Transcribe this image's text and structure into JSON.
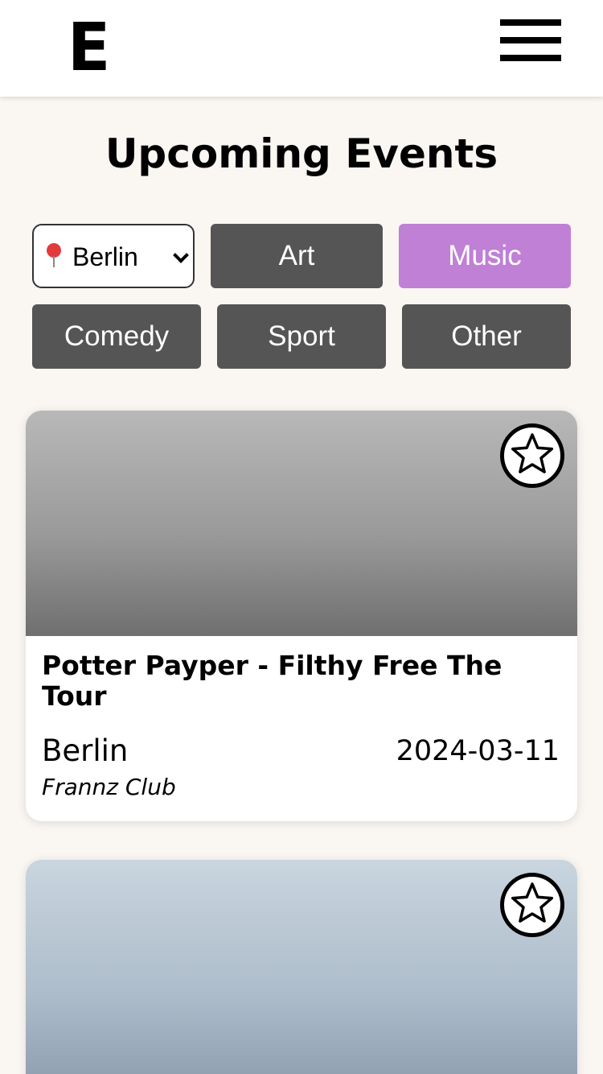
{
  "header": {
    "logo_text": "E",
    "menu_icon": "hamburger-menu-icon"
  },
  "page": {
    "title": "Upcoming Events"
  },
  "filters": {
    "city": {
      "selected": "Berlin",
      "icon": "location-pin-icon"
    },
    "categories": [
      {
        "label": "Art",
        "active": false
      },
      {
        "label": "Music",
        "active": true
      },
      {
        "label": "Comedy",
        "active": false
      },
      {
        "label": "Sport",
        "active": false
      },
      {
        "label": "Other",
        "active": false
      }
    ],
    "active_color": "#bf80d5",
    "inactive_color": "#555555"
  },
  "events": [
    {
      "title": "Potter Payper - Filthy Free The Tour",
      "city": "Berlin",
      "date": "2024-03-11",
      "venue": "Frannz Club",
      "favorite_icon": "star-outline-icon"
    },
    {
      "title": "",
      "city": "",
      "date": "",
      "venue": "",
      "favorite_icon": "star-outline-icon"
    }
  ]
}
